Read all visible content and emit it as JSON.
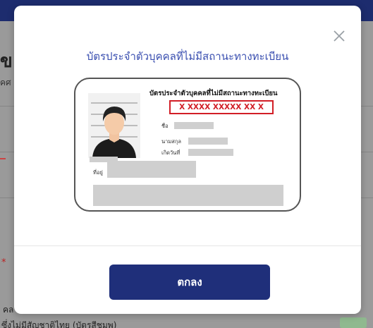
{
  "background": {
    "heading": "ข",
    "sub": "คศ",
    "star": "*",
    "line1": "คล",
    "line2": "ซึ่งไม่มีสัญชาติไทย (บัตรสีชมพู)"
  },
  "modal": {
    "title": "บัตรประจำตัวบุคคลที่ไม่มีสถานะทางทะเบียน",
    "close_icon": "close-icon",
    "ok_label": "ตกลง"
  },
  "card": {
    "title": "บัตรประจำตัวบุคคลที่ไม่มีสถานะทางทะเบียน",
    "id_number_mask": "X XXXX XXXXX XX X",
    "labels": {
      "name": "ชื่อ",
      "surname": "นามสกุล",
      "birth": "เกิดวันที่",
      "address": "ที่อยู่"
    }
  },
  "colors": {
    "accent_title": "#3a4fb0",
    "button_bg": "#1f2f7a",
    "highlight_red": "#d21e26"
  }
}
